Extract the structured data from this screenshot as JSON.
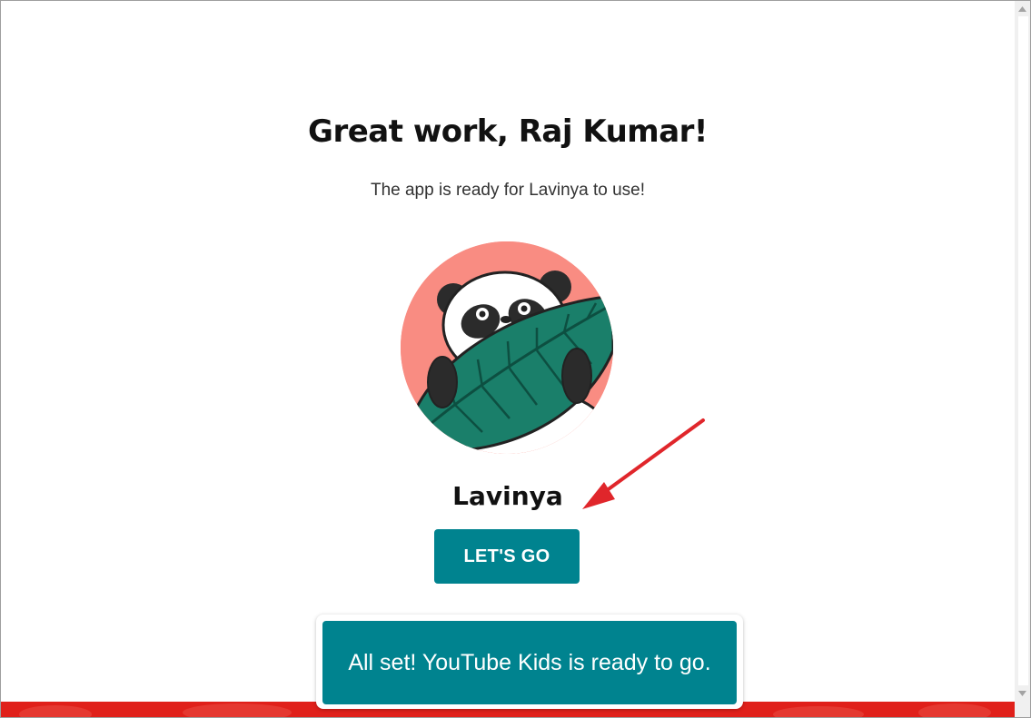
{
  "heading": "Great work, Raj Kumar!",
  "subheading": "The app is ready for Lavinya to use!",
  "profile": {
    "name": "Lavinya",
    "avatar_icon": "panda-with-leaf-icon",
    "avatar_bg": "#f98c82"
  },
  "actions": {
    "go_label": "LET'S GO"
  },
  "toast": {
    "message": "All set! YouTube Kids is ready to go."
  },
  "colors": {
    "accent": "#00838f",
    "annotation_arrow": "#e0262b",
    "band": "#e0201a"
  }
}
